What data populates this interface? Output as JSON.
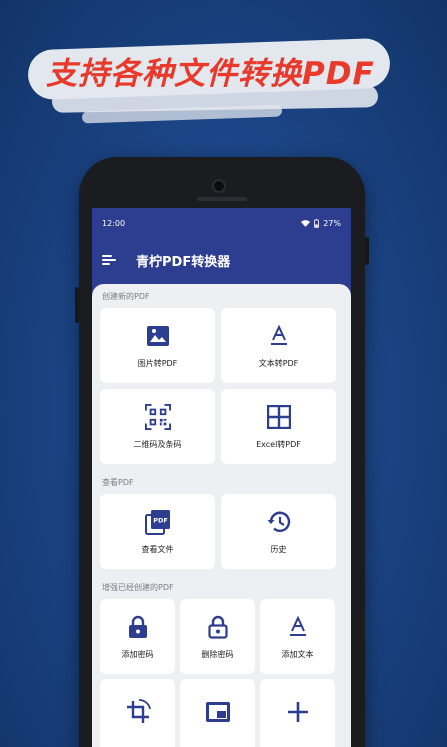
{
  "banner": {
    "title": "支持各种文件转换PDF"
  },
  "status_bar": {
    "time": "12:00",
    "battery": "27%"
  },
  "app_bar": {
    "title": "青柠PDF转换器"
  },
  "sections": {
    "create": {
      "title": "创建新的PDF",
      "items": [
        {
          "label": "图片转PDF",
          "icon": "image-icon"
        },
        {
          "label": "文本转PDF",
          "icon": "text-format-icon"
        },
        {
          "label": "二维码及条码",
          "icon": "qr-code-icon"
        },
        {
          "label": "Excel转PDF",
          "icon": "grid-icon"
        }
      ]
    },
    "view": {
      "title": "查看PDF",
      "items": [
        {
          "label": "查看文件",
          "icon": "pdf-file-icon"
        },
        {
          "label": "历史",
          "icon": "history-icon"
        }
      ]
    },
    "enhance": {
      "title": "增强已经创建的PDF",
      "items": [
        {
          "label": "添加密码",
          "icon": "lock-icon"
        },
        {
          "label": "删除密码",
          "icon": "unlock-icon"
        },
        {
          "label": "添加文本",
          "icon": "text-format-icon"
        },
        {
          "label": "",
          "icon": "rotate-icon"
        },
        {
          "label": "",
          "icon": "watermark-icon"
        },
        {
          "label": "",
          "icon": "plus-icon"
        }
      ]
    }
  },
  "colors": {
    "accent": "#2d3d8f",
    "banner_text": "#e8392b",
    "background": "#1c4688"
  }
}
